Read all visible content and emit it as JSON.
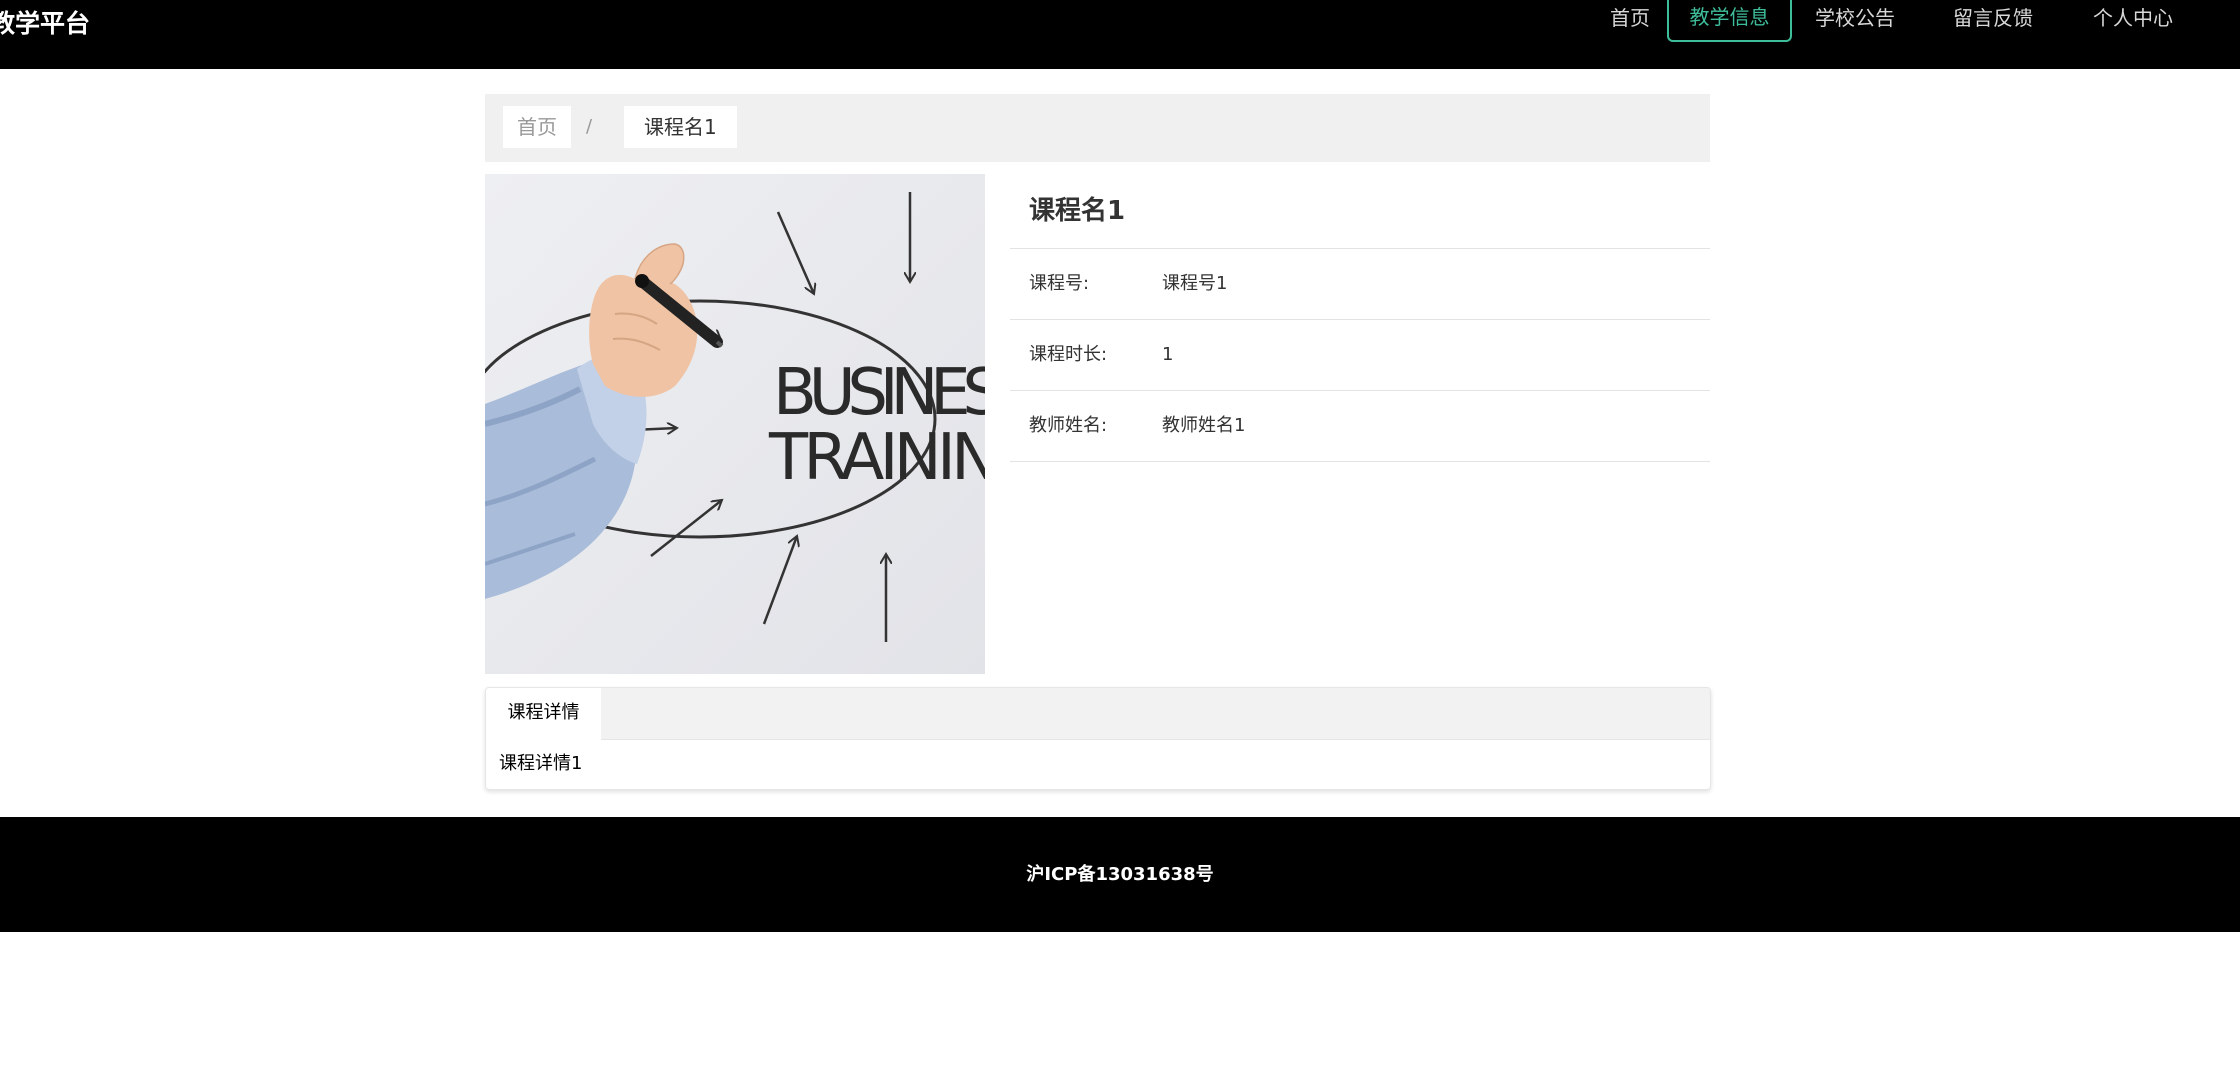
{
  "header": {
    "site_title": "教学平台",
    "nav": [
      {
        "label": "首页",
        "active": false
      },
      {
        "label": "教学信息",
        "active": true
      },
      {
        "label": "学校公告",
        "active": false
      },
      {
        "label": "留言反馈",
        "active": false
      },
      {
        "label": "个人中心",
        "active": false
      }
    ],
    "accent_color": "#3ebd9a"
  },
  "breadcrumb": {
    "home": "首页",
    "separator": "/",
    "current": "课程名1"
  },
  "image": {
    "text_line1": "BUSINES",
    "text_line2": "TRAININ"
  },
  "course": {
    "title": "课程名1",
    "fields": [
      {
        "label": "课程号:",
        "value": "课程号1"
      },
      {
        "label": "课程时长:",
        "value": "1"
      },
      {
        "label": "教师姓名:",
        "value": "教师姓名1"
      }
    ]
  },
  "details": {
    "tab_label": "课程详情",
    "content": "课程详情1"
  },
  "footer": {
    "icp": "沪ICP备13031638号"
  }
}
